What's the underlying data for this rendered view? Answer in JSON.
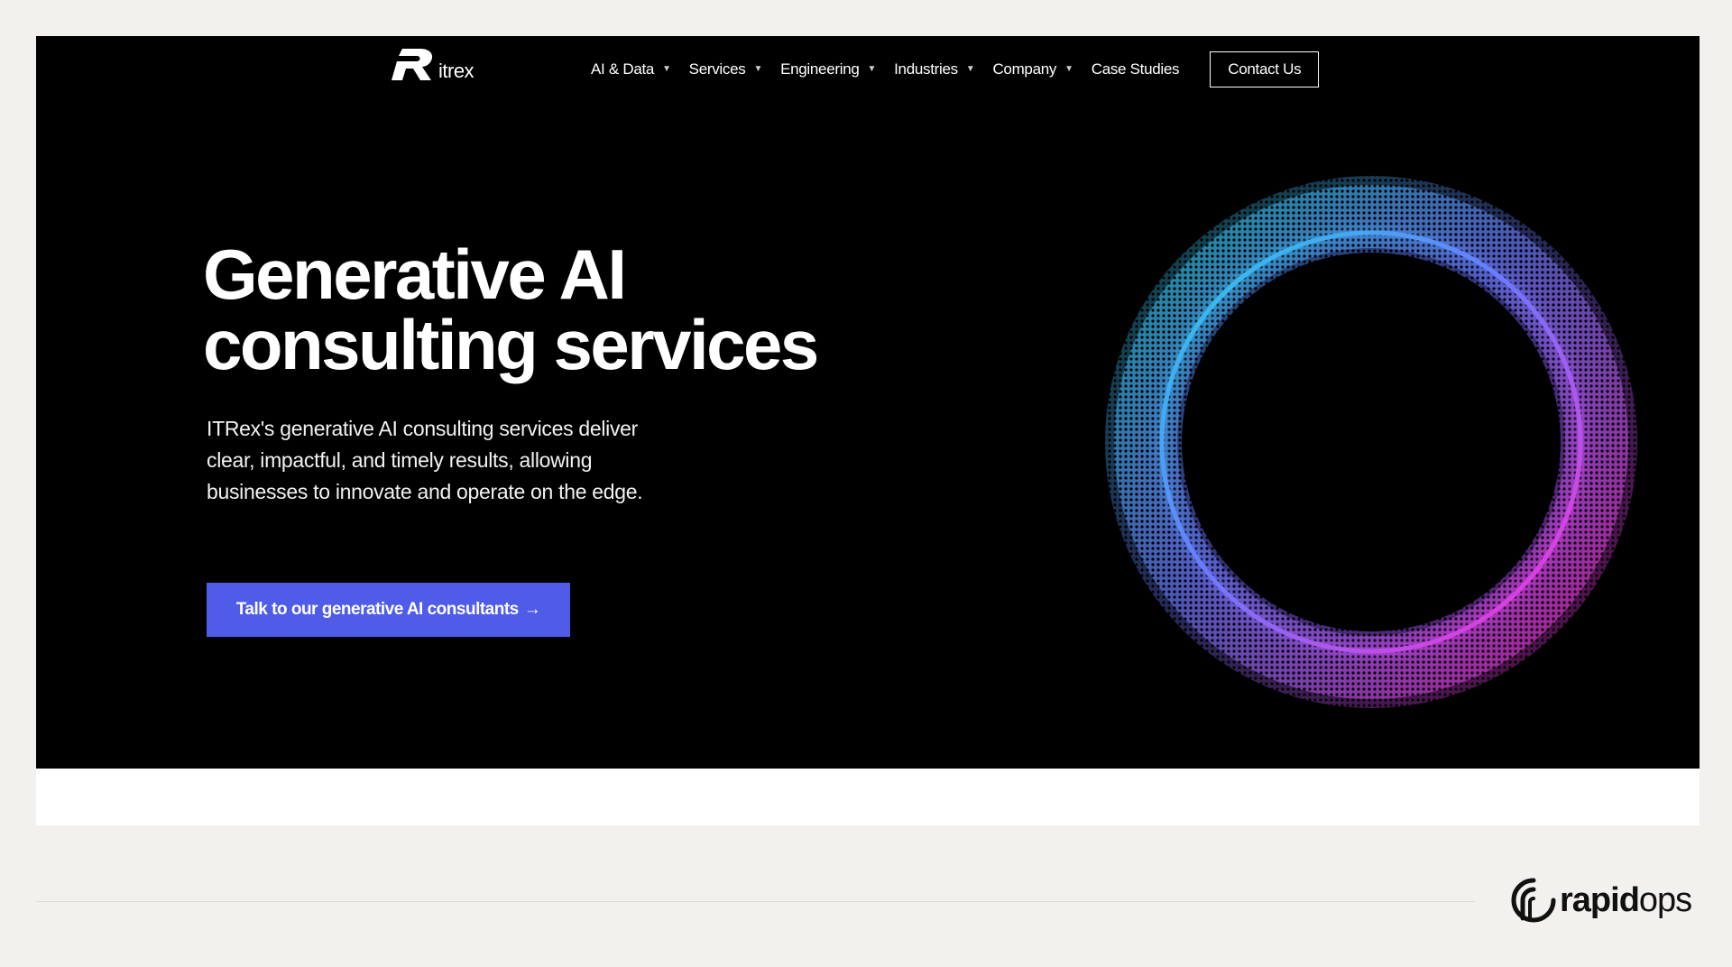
{
  "header": {
    "logo_text": "itrex",
    "nav": [
      {
        "label": "AI & Data",
        "has_dropdown": true
      },
      {
        "label": "Services",
        "has_dropdown": true
      },
      {
        "label": "Engineering",
        "has_dropdown": true
      },
      {
        "label": "Industries",
        "has_dropdown": true
      },
      {
        "label": "Company",
        "has_dropdown": true
      },
      {
        "label": "Case Studies",
        "has_dropdown": false
      }
    ],
    "contact_label": "Contact Us",
    "caret_icon": "caret-down-icon"
  },
  "hero": {
    "title_line1": "Generative AI",
    "title_line2": "consulting services",
    "description": "ITRex's generative AI consulting services deliver clear, impactful, and timely results, allowing businesses to innovate and operate on the edge.",
    "cta_label": "Talk to our generative AI consultants",
    "cta_arrow": "→",
    "cta_color": "#4f5ce8",
    "ring_colors": [
      "#22d3e6",
      "#ff2bd6"
    ]
  },
  "footer": {
    "brand_bold": "rapid",
    "brand_light": "ops"
  }
}
